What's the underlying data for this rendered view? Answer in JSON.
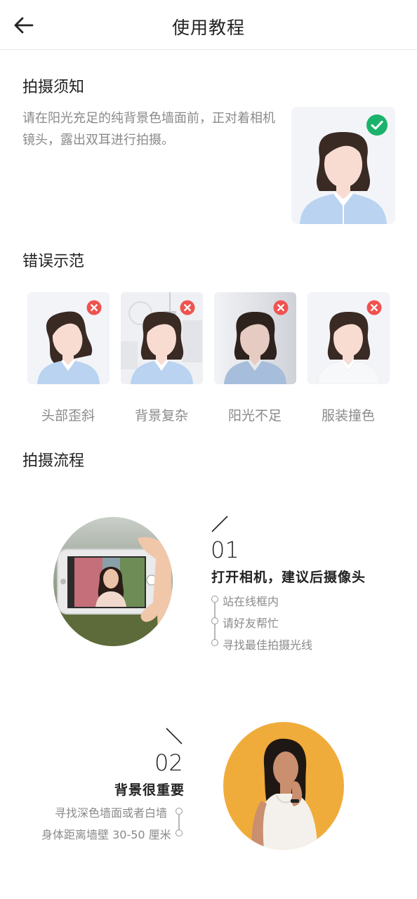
{
  "header": {
    "back_icon": "arrow-left-icon",
    "title": "使用教程"
  },
  "notice": {
    "title": "拍摄须知",
    "text": "请在阳光充足的纯背景色墙面前，正对着相机镜头，露出双耳进行拍摄。",
    "badge_icon": "check-circle-icon",
    "badge_color": "#1bb36b"
  },
  "wrong": {
    "title": "错误示范",
    "badge_icon": "x-circle-icon",
    "badge_color": "#ef5350",
    "items": [
      {
        "label": "头部歪斜"
      },
      {
        "label": "背景复杂"
      },
      {
        "label": "阳光不足"
      },
      {
        "label": "服装撞色"
      }
    ]
  },
  "process": {
    "title": "拍摄流程",
    "steps": [
      {
        "number": "01",
        "title": "打开相机，建议后摄像头",
        "tips": [
          "站在线框内",
          "请好友帮忙",
          "寻找最佳拍摄光线"
        ]
      },
      {
        "number": "02",
        "title": "背景很重要",
        "tips": [
          "寻找深色墙面或者白墙",
          "身体距离墙壁 30-50 厘米"
        ]
      }
    ]
  },
  "colors": {
    "shirt": "#b9d3f0",
    "hair": "#3a2a24",
    "skin": "#f8dcd2",
    "yellow_bg": "#f0ac3a"
  }
}
